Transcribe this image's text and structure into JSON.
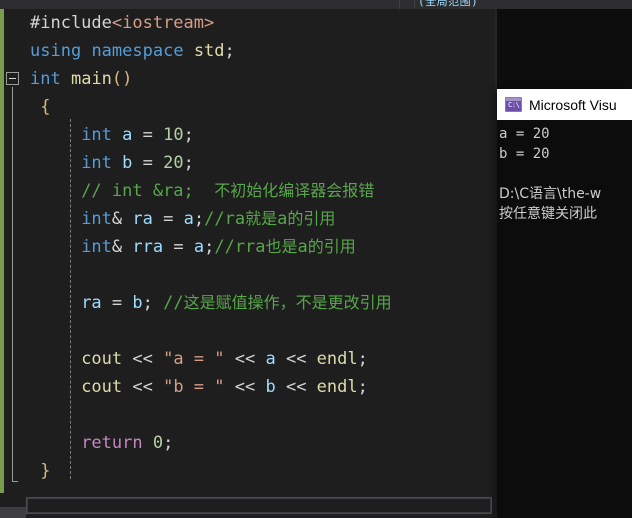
{
  "window": {
    "app": "visual-studio-code-editor",
    "top_cut_label": "(全局范围)"
  },
  "colors": {
    "editor_background": "#1e1e1e",
    "change_bar_green": "#7a9c4f",
    "keyword_blue": "#569cd6",
    "comment_green": "#57a64a",
    "string_orange": "#d69d85",
    "function_yellow": "#dcdcaa",
    "variable_lightblue": "#9cdcfe",
    "number_green": "#b5cea8",
    "control_purple": "#c586c0",
    "brace_gold": "#d7ba7d",
    "console_background": "#0c0c0c",
    "console_titlebar": "#ffffff",
    "console_icon_purple": "#6b4fa8"
  },
  "editor": {
    "fold_marker": "collapse-minus",
    "lines": [
      {
        "id": "line-include",
        "tokens": [
          {
            "t": "#include",
            "c": "t-pp"
          },
          {
            "t": "<iostream>",
            "c": "t-str"
          }
        ]
      },
      {
        "id": "line-using",
        "tokens": [
          {
            "t": "using",
            "c": "t-kw"
          },
          {
            "t": " ",
            "c": "t-op"
          },
          {
            "t": "namespace",
            "c": "t-kw"
          },
          {
            "t": " ",
            "c": "t-op"
          },
          {
            "t": "std",
            "c": "t-fn"
          },
          {
            "t": ";",
            "c": "t-punc"
          }
        ]
      },
      {
        "id": "line-main",
        "tokens": [
          {
            "t": "int",
            "c": "t-type"
          },
          {
            "t": " ",
            "c": "t-op"
          },
          {
            "t": "main",
            "c": "t-fn"
          },
          {
            "t": "()",
            "c": "t-brace"
          }
        ]
      },
      {
        "id": "line-open-brace",
        "tokens": [
          {
            "t": " ",
            "c": "t-op"
          },
          {
            "t": "{",
            "c": "t-brace"
          }
        ]
      },
      {
        "id": "line-int-a",
        "tokens": [
          {
            "t": "     ",
            "c": "t-op"
          },
          {
            "t": "int",
            "c": "t-type"
          },
          {
            "t": " ",
            "c": "t-op"
          },
          {
            "t": "a",
            "c": "t-var"
          },
          {
            "t": " = ",
            "c": "t-op"
          },
          {
            "t": "10",
            "c": "t-num"
          },
          {
            "t": ";",
            "c": "t-punc"
          }
        ]
      },
      {
        "id": "line-int-b",
        "tokens": [
          {
            "t": "     ",
            "c": "t-op"
          },
          {
            "t": "int",
            "c": "t-type"
          },
          {
            "t": " ",
            "c": "t-op"
          },
          {
            "t": "b",
            "c": "t-var"
          },
          {
            "t": " = ",
            "c": "t-op"
          },
          {
            "t": "20",
            "c": "t-num"
          },
          {
            "t": ";",
            "c": "t-punc"
          }
        ]
      },
      {
        "id": "line-comment-noinit",
        "tokens": [
          {
            "t": "     ",
            "c": "t-op"
          },
          {
            "t": "// int &ra;  ",
            "c": "t-comment"
          },
          {
            "t": "不初始化编译器会报错",
            "c": "t-comment cjk"
          }
        ]
      },
      {
        "id": "line-ref-ra",
        "tokens": [
          {
            "t": "     ",
            "c": "t-op"
          },
          {
            "t": "int",
            "c": "t-type"
          },
          {
            "t": "&",
            "c": "t-op"
          },
          {
            "t": " ",
            "c": "t-op"
          },
          {
            "t": "ra",
            "c": "t-var"
          },
          {
            "t": " = ",
            "c": "t-op"
          },
          {
            "t": "a",
            "c": "t-var"
          },
          {
            "t": ";",
            "c": "t-punc"
          },
          {
            "t": "//ra",
            "c": "t-comment"
          },
          {
            "t": "就是",
            "c": "t-comment cjk"
          },
          {
            "t": "a",
            "c": "t-comment"
          },
          {
            "t": "的引用",
            "c": "t-comment cjk"
          }
        ]
      },
      {
        "id": "line-ref-rra",
        "tokens": [
          {
            "t": "     ",
            "c": "t-op"
          },
          {
            "t": "int",
            "c": "t-type"
          },
          {
            "t": "&",
            "c": "t-op"
          },
          {
            "t": " ",
            "c": "t-op"
          },
          {
            "t": "rra",
            "c": "t-var"
          },
          {
            "t": " = ",
            "c": "t-op"
          },
          {
            "t": "a",
            "c": "t-var"
          },
          {
            "t": ";",
            "c": "t-punc"
          },
          {
            "t": "//rra",
            "c": "t-comment"
          },
          {
            "t": "也是",
            "c": "t-comment cjk"
          },
          {
            "t": "a",
            "c": "t-comment"
          },
          {
            "t": "的引用",
            "c": "t-comment cjk"
          }
        ]
      },
      {
        "id": "line-blank-1",
        "tokens": [
          {
            "t": " ",
            "c": "t-op"
          }
        ]
      },
      {
        "id": "line-assign-ra",
        "tokens": [
          {
            "t": "     ",
            "c": "t-op"
          },
          {
            "t": "ra",
            "c": "t-var"
          },
          {
            "t": " = ",
            "c": "t-op"
          },
          {
            "t": "b",
            "c": "t-var"
          },
          {
            "t": "; ",
            "c": "t-punc"
          },
          {
            "t": "//",
            "c": "t-comment"
          },
          {
            "t": "这是赋值操作，不是更改引用",
            "c": "t-comment cjk"
          }
        ]
      },
      {
        "id": "line-blank-2",
        "tokens": [
          {
            "t": " ",
            "c": "t-op"
          }
        ]
      },
      {
        "id": "line-cout-a",
        "tokens": [
          {
            "t": "     ",
            "c": "t-op"
          },
          {
            "t": "cout",
            "c": "t-fn"
          },
          {
            "t": " << ",
            "c": "t-op"
          },
          {
            "t": "\"a = \"",
            "c": "t-str"
          },
          {
            "t": " << ",
            "c": "t-op"
          },
          {
            "t": "a",
            "c": "t-var"
          },
          {
            "t": " << ",
            "c": "t-op"
          },
          {
            "t": "endl",
            "c": "t-fn"
          },
          {
            "t": ";",
            "c": "t-punc"
          }
        ]
      },
      {
        "id": "line-cout-b",
        "tokens": [
          {
            "t": "     ",
            "c": "t-op"
          },
          {
            "t": "cout",
            "c": "t-fn"
          },
          {
            "t": " << ",
            "c": "t-op"
          },
          {
            "t": "\"b = \"",
            "c": "t-str"
          },
          {
            "t": " << ",
            "c": "t-op"
          },
          {
            "t": "b",
            "c": "t-var"
          },
          {
            "t": " << ",
            "c": "t-op"
          },
          {
            "t": "endl",
            "c": "t-fn"
          },
          {
            "t": ";",
            "c": "t-punc"
          }
        ]
      },
      {
        "id": "line-blank-3",
        "tokens": [
          {
            "t": " ",
            "c": "t-op"
          }
        ]
      },
      {
        "id": "line-return",
        "tokens": [
          {
            "t": "     ",
            "c": "t-op"
          },
          {
            "t": "return",
            "c": "t-ctrl"
          },
          {
            "t": " ",
            "c": "t-op"
          },
          {
            "t": "0",
            "c": "t-num"
          },
          {
            "t": ";",
            "c": "t-punc"
          }
        ]
      },
      {
        "id": "line-close-brace",
        "tokens": [
          {
            "t": " ",
            "c": "t-op"
          },
          {
            "t": "}",
            "c": "t-brace"
          }
        ]
      }
    ]
  },
  "console": {
    "title": "Microsoft Visu",
    "icon": "console-window-icon",
    "icon_text": "C:\\",
    "lines": [
      {
        "id": "console-a",
        "text": "a = 20",
        "cjk": false
      },
      {
        "id": "console-b",
        "text": "b = 20",
        "cjk": false
      },
      {
        "id": "console-blank",
        "text": "",
        "cjk": false
      },
      {
        "id": "console-path",
        "text": "D:\\C语言\\the-w",
        "cjk": true
      },
      {
        "id": "console-prompt",
        "text": "按任意键关闭此",
        "cjk": true
      }
    ]
  }
}
